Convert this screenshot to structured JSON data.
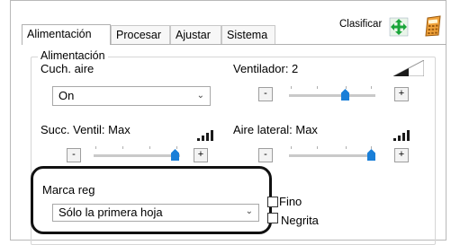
{
  "tabs": [
    {
      "label": "Alimentación",
      "active": true
    },
    {
      "label": "Procesar",
      "active": false
    },
    {
      "label": "Ajustar",
      "active": false
    },
    {
      "label": "Sistema",
      "active": false
    }
  ],
  "toolbar": {
    "sort_label": "Clasificar",
    "sort_icon": "arrows-move-icon",
    "calculator_icon": "calculator-icon"
  },
  "group": {
    "title": "Alimentación"
  },
  "air_cushion": {
    "label": "Cuch. aire",
    "value": "On"
  },
  "fan": {
    "label": "Ventilador: 2",
    "level": 2,
    "max": 4
  },
  "suction": {
    "label": "Succ. Ventil: Max",
    "level": 4,
    "max": 4
  },
  "side_air": {
    "label": "Aire lateral: Max",
    "level": 4,
    "max": 4
  },
  "mark": {
    "label": "Marca reg",
    "value": "Sólo la primera hoja"
  },
  "checkboxes": {
    "thin": {
      "label": "Fino",
      "checked": false
    },
    "bold": {
      "label": "Negrita",
      "checked": false
    }
  },
  "buttons": {
    "minus": "-",
    "plus": "+"
  },
  "colors": {
    "accent": "#1a7fd8",
    "callout": "#111111"
  }
}
